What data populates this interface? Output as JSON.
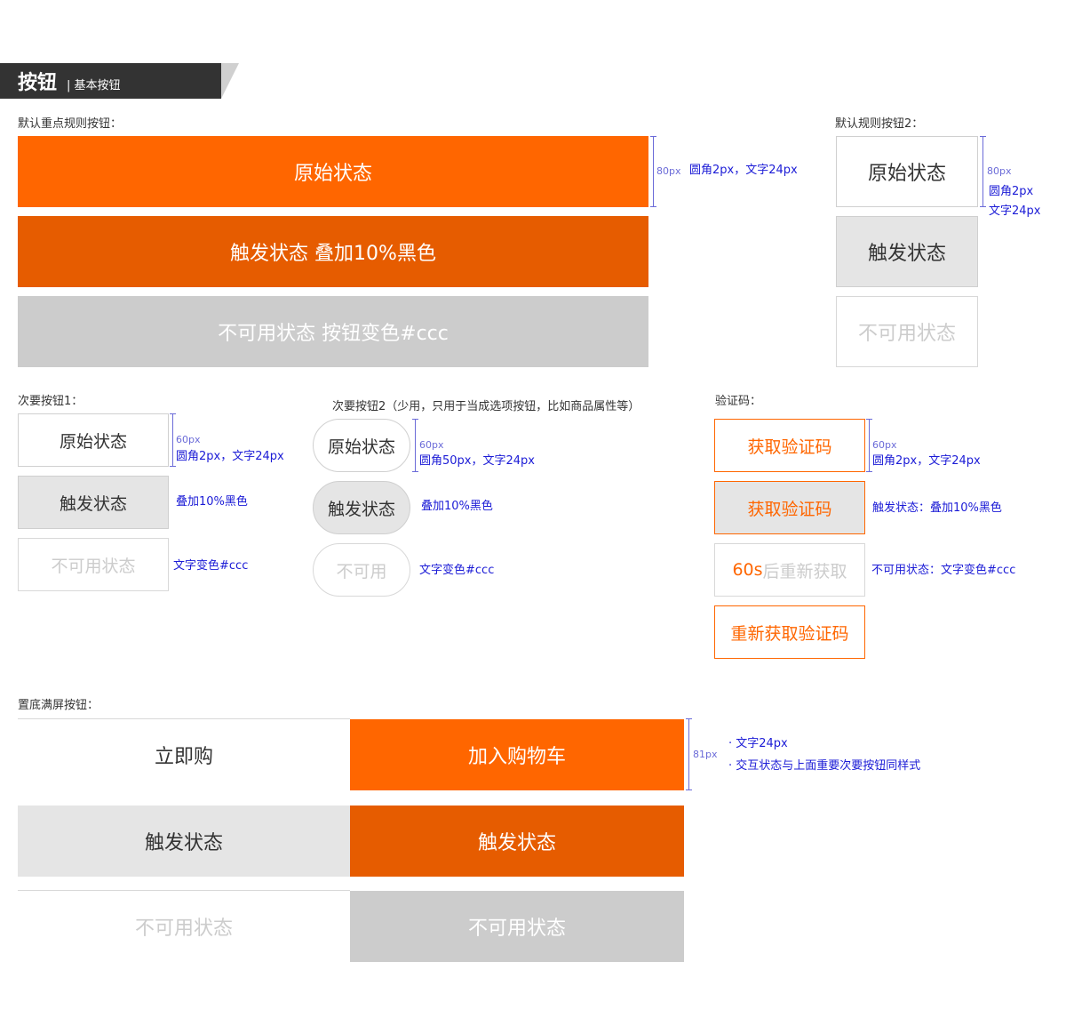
{
  "header": {
    "title": "按钮",
    "subtitle": "| 基本按钮"
  },
  "primary": {
    "label": "默认重点规则按钮：",
    "normal": "原始状态",
    "pressed": "触发状态 叠加10%黑色",
    "disabled": "不可用状态 按钮变色#ccc",
    "size": "80px",
    "spec": "圆角2px，文字24px"
  },
  "primary2": {
    "label": "默认规则按钮2：",
    "normal": "原始状态",
    "pressed": "触发状态",
    "disabled": "不可用状态",
    "size": "80px",
    "spec1": "圆角2px",
    "spec2": "文字24px"
  },
  "secondary1": {
    "label": "次要按钮1：",
    "normal": "原始状态",
    "pressed": "触发状态",
    "disabled": "不可用状态",
    "size": "60px",
    "spec": "圆角2px，文字24px",
    "pressed_note": "叠加10%黑色",
    "disabled_note": "文字变色#ccc"
  },
  "secondary2": {
    "label": "次要按钮2（少用，只用于当成选项按钮，比如商品属性等）",
    "normal": "原始状态",
    "pressed": "触发状态",
    "disabled": "不可用",
    "size": "60px",
    "spec": "圆角50px，文字24px",
    "pressed_note": "叠加10%黑色",
    "disabled_note": "文字变色#ccc"
  },
  "captcha": {
    "label": "验证码：",
    "normal": "获取验证码",
    "pressed": "获取验证码",
    "countdown_num": "60s",
    "countdown_text": "后重新获取",
    "retry": "重新获取验证码",
    "size": "60px",
    "spec": "圆角2px，文字24px",
    "pressed_note": "触发状态：叠加10%黑色",
    "disabled_note": "不可用状态：文字变色#ccc"
  },
  "bottom": {
    "label": "置底满屏按钮：",
    "buy_now": "立即购",
    "add_cart": "加入购物车",
    "pressed_left": "触发状态",
    "pressed_right": "触发状态",
    "disabled_left": "不可用状态",
    "disabled_right": "不可用状态",
    "size": "81px",
    "note1": "· 文字24px",
    "note2": "· 交互状态与上面重要次要按钮同样式"
  },
  "colors": {
    "orange": "#ff6600",
    "orange_pressed": "#e65c00",
    "disabled": "#cccccc",
    "annotation": "#1b1bd6"
  }
}
